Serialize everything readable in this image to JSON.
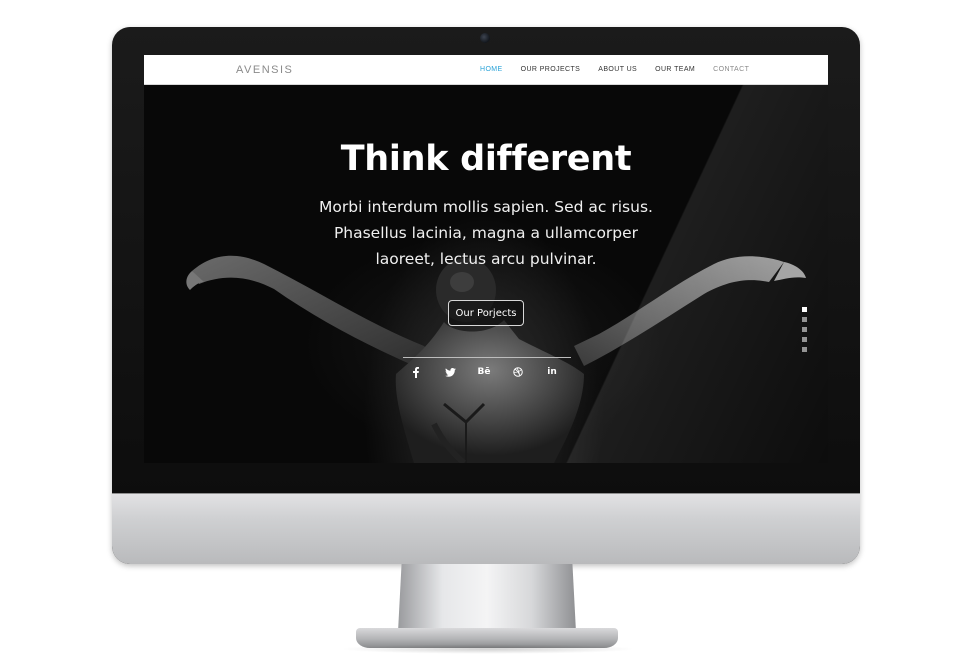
{
  "nav": {
    "logo": "AVENSIS",
    "links": [
      {
        "label": "HOME",
        "active": true
      },
      {
        "label": "OUR PROJECTS",
        "active": false
      },
      {
        "label": "ABOUT US",
        "active": false
      },
      {
        "label": "OUR TEAM",
        "active": false
      },
      {
        "label": "CONTACT",
        "active": false
      }
    ],
    "active_color": "#2aa3d8"
  },
  "hero": {
    "title": "Think different",
    "subtitle": "Morbi interdum mollis sapien. Sed ac risus. Phasellus lacinia, magna a ullamcorper laoreet, lectus arcu pulvinar.",
    "button_label": "Our Porjects",
    "social_icons": [
      "facebook-icon",
      "twitter-icon",
      "behance-icon",
      "dribbble-icon",
      "linkedin-icon"
    ],
    "behance_text": "Bē",
    "linkedin_text": "in"
  },
  "slider": {
    "total": 5,
    "active_index": 0
  }
}
